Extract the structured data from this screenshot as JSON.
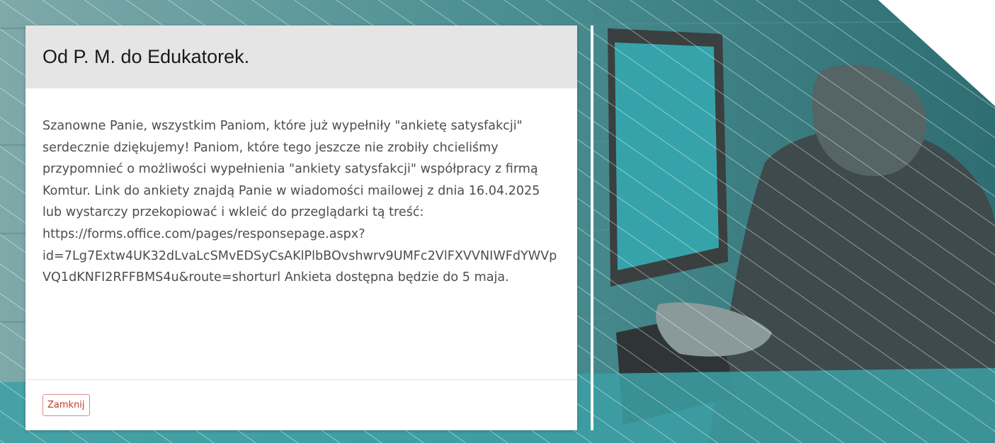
{
  "modal": {
    "title": "Od P. M. do Edukatorek.",
    "body": "Szanowne Panie, wszystkim Paniom, które już wypełniły \"ankietę satysfakcji\" serdecznie dziękujemy! Paniom, które tego jeszcze nie zrobiły chcieliśmy przypomnieć o możliwości wypełnienia \"ankiety satysfakcji\" współpracy z firmą Komtur. Link do ankiety znajdą Panie w wiadomości mailowej z dnia 16.04.2025 lub wystarczy przekopiować i wkleić do przeglądarki tą treść: https://forms.office.com/pages/responsepage.aspx?id=7Lg7Extw4UK32dLvaLcSMvEDSyCsAKlPlbBOvshwrv9UMFc2VlFXVVNIWFdYWVpVQ1dKNFI2RFFBMS4u&route=shorturl Ankieta dostępna będzie do 5 maja.",
    "close_label": "Zamknij"
  },
  "colors": {
    "teal": "#3ba0a6",
    "accent_red": "#c0392b",
    "header_bg": "#e5e5e5"
  }
}
